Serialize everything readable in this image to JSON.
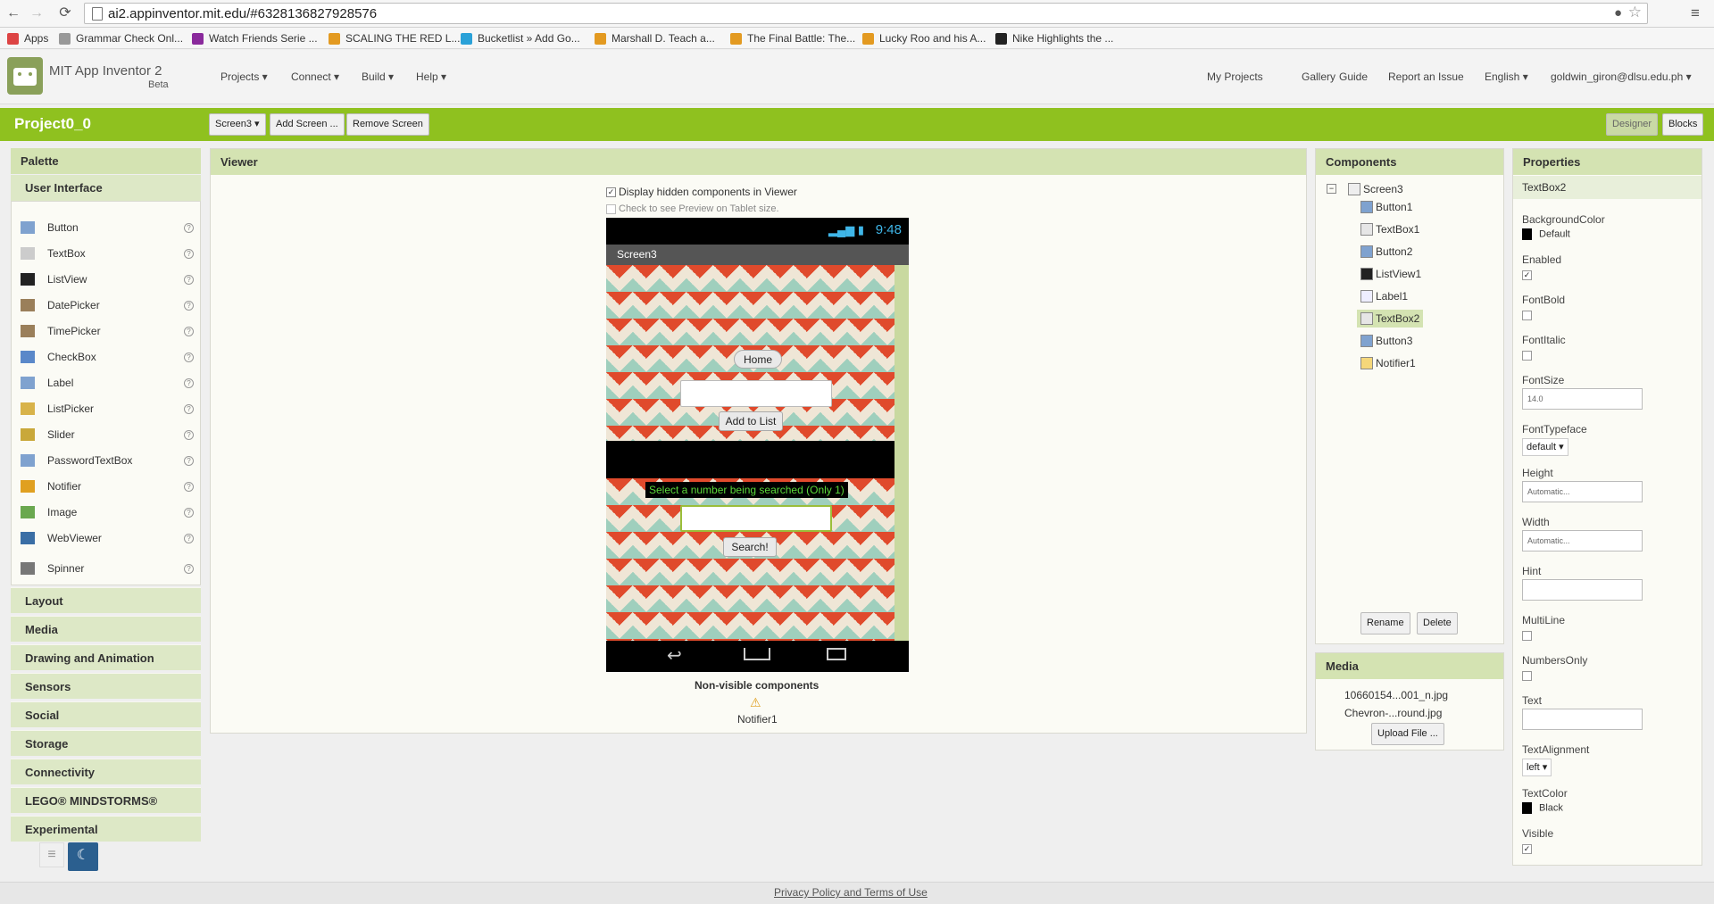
{
  "browser": {
    "url": "ai2.appinventor.mit.edu/#6328136827928576",
    "bookmarks": [
      {
        "label": "Apps",
        "color": "#d44"
      },
      {
        "label": "Grammar Check Onl...",
        "color": "#999"
      },
      {
        "label": "Watch Friends Serie ...",
        "color": "#8a2a9c"
      },
      {
        "label": "SCALING THE RED L...",
        "color": "#e39a21"
      },
      {
        "label": "Bucketlist » Add Go...",
        "color": "#2aa1d8"
      },
      {
        "label": "Marshall D. Teach a...",
        "color": "#e39a21"
      },
      {
        "label": "The Final Battle: The...",
        "color": "#e39a21"
      },
      {
        "label": "Lucky Roo and his A...",
        "color": "#e39a21"
      },
      {
        "label": "Nike Highlights the ...",
        "color": "#222"
      }
    ]
  },
  "header": {
    "app_name": "MIT App Inventor 2",
    "beta": "Beta",
    "menus": [
      "Projects ▾",
      "Connect ▾",
      "Build ▾",
      "Help ▾"
    ],
    "right_links": [
      "My Projects",
      "Gallery",
      "Guide",
      "Report an Issue",
      "English ▾",
      "goldwin_giron@dlsu.edu.ph ▾"
    ]
  },
  "project": {
    "name": "Project0_0",
    "screen_select": "Screen3 ▾",
    "add_screen": "Add Screen ...",
    "remove_screen": "Remove Screen",
    "designer": "Designer",
    "blocks": "Blocks"
  },
  "palette": {
    "title": "Palette",
    "open_drawer": "User Interface",
    "items": [
      "Button",
      "TextBox",
      "ListView",
      "DatePicker",
      "TimePicker",
      "CheckBox",
      "Label",
      "ListPicker",
      "Slider",
      "PasswordTextBox",
      "Notifier",
      "Image",
      "WebViewer",
      "Spinner"
    ],
    "drawers": [
      "Layout",
      "Media",
      "Drawing and Animation",
      "Sensors",
      "Social",
      "Storage",
      "Connectivity",
      "LEGO® MINDSTORMS®",
      "Experimental"
    ]
  },
  "viewer": {
    "title": "Viewer",
    "display_hidden": "Display hidden components in Viewer",
    "tablet_preview": "Check to see Preview on Tablet size.",
    "status_time": "9:48",
    "screen_title": "Screen3",
    "home_button": "Home",
    "add_button": "Add to List",
    "search_label": "Select a number being searched (Only 1)",
    "search_button": "Search!",
    "nonvisible_title": "Non-visible components",
    "nonvisible_item": "Notifier1"
  },
  "components": {
    "title": "Components",
    "root": "Screen3",
    "items": [
      "Button1",
      "TextBox1",
      "Button2",
      "ListView1",
      "Label1",
      "TextBox2",
      "Button3",
      "Notifier1"
    ],
    "selected": "TextBox2",
    "rename": "Rename",
    "delete": "Delete"
  },
  "media": {
    "title": "Media",
    "files": [
      "10660154...001_n.jpg",
      "Chevron-...round.jpg"
    ],
    "upload": "Upload File ..."
  },
  "properties": {
    "title": "Properties",
    "component": "TextBox2",
    "background_label": "BackgroundColor",
    "background_value": "Default",
    "enabled_label": "Enabled",
    "fontbold_label": "FontBold",
    "fontitalic_label": "FontItalic",
    "fontsize_label": "FontSize",
    "fontsize_value": "14.0",
    "fonttypeface_label": "FontTypeface",
    "fonttypeface_value": "default ▾",
    "height_label": "Height",
    "height_value": "Automatic...",
    "width_label": "Width",
    "width_value": "Automatic...",
    "hint_label": "Hint",
    "multiline_label": "MultiLine",
    "numbersonly_label": "NumbersOnly",
    "text_label": "Text",
    "textalignment_label": "TextAlignment",
    "textalignment_value": "left ▾",
    "textcolor_label": "TextColor",
    "textcolor_value": "Black",
    "visible_label": "Visible"
  },
  "footer": {
    "privacy": "Privacy Policy and Terms of Use"
  },
  "colors": {
    "green_bar": "#8fc11f",
    "panel_header": "#d4e3b2",
    "selected_item": "#d4e3b2"
  }
}
